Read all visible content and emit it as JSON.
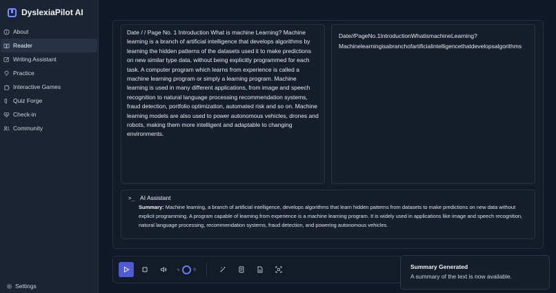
{
  "app": {
    "name": "DyslexiaPilot AI"
  },
  "sidebar": {
    "items": [
      {
        "label": "About",
        "icon": "info-icon",
        "active": false
      },
      {
        "label": "Reader",
        "icon": "book-icon",
        "active": true
      },
      {
        "label": "Writing Assistant",
        "icon": "pencil-icon",
        "active": false
      },
      {
        "label": "Practice",
        "icon": "lightbulb-icon",
        "active": false
      },
      {
        "label": "Interactive Games",
        "icon": "puzzle-icon",
        "active": false
      },
      {
        "label": "Quiz Forge",
        "icon": "brain-icon",
        "active": false
      },
      {
        "label": "Check-in",
        "icon": "heart-pulse-icon",
        "active": false
      },
      {
        "label": "Community",
        "icon": "users-icon",
        "active": false
      }
    ],
    "settings_label": "Settings"
  },
  "reader": {
    "original_text": "Date / / Page No. 1 Introduction What is machine Learning? Machine learning is a branch of artificial intelligence that develops algorithms by learning the hidden patterns of the datasets used it to make predictions on new similar type data, without being explicitly programmed for each task. A computer program which learns from experience is called a machine learning program or simply a learning program. Machine learning is used in many different applications, from image and speech recognition to natural language processing recommendation systems, fraud detection, portfolio optimization, automated risk and so on. Machine learning models are also used to power autonomous vehicles, drones and robots, making them more intelligent and adaptable to changing environments.",
    "dyslexic_line1": "Date//PageNo.1IntroductionWhatismachineLearning?",
    "dyslexic_line2": "Machinelearningisabranchofartificialintelligencethatdevelopsalgorithms"
  },
  "assistant": {
    "title": "AI Assistant",
    "summary_label": "Summary:",
    "summary_text": "Machine learning, a branch of artificial intelligence, develops algorithms that learn hidden patterns from datasets to make predictions on new data without explicit programming. A program capable of learning from experience is a machine learning program. It is widely used in applications like image and speech recognition, natural language processing, recommendation systems, fraud detection, and powering autonomous vehicles."
  },
  "toolbar": {
    "speed_value": 0.5,
    "colors": {
      "primary": "#4f5bd5",
      "knob": "#6b7bf0"
    }
  },
  "toast": {
    "title": "Summary Generated",
    "message": "A summary of the text is now available."
  },
  "colors": {
    "background": "#111827",
    "sidebar": "#1b2433",
    "accent": "#7b8cff"
  }
}
